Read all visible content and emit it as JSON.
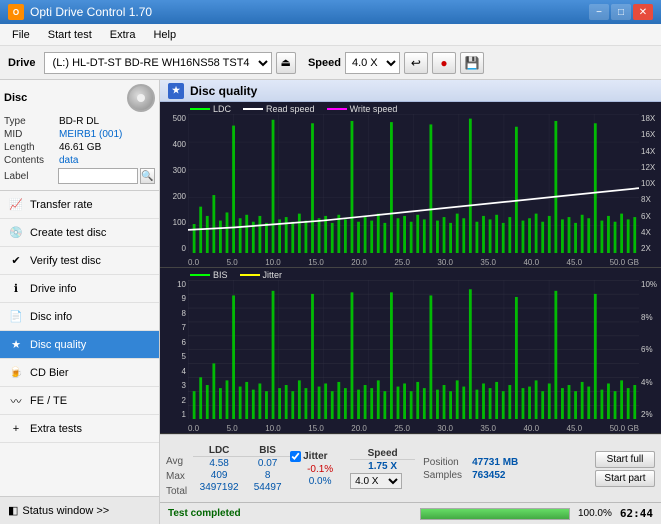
{
  "titleBar": {
    "appName": "Opti Drive Control 1.70",
    "iconText": "O",
    "btnMin": "−",
    "btnMax": "□",
    "btnClose": "✕"
  },
  "menuBar": {
    "items": [
      "File",
      "Start test",
      "Extra",
      "Help"
    ]
  },
  "toolbar": {
    "driveLabel": "Drive",
    "driveValue": "(L:)  HL-DT-ST BD-RE  WH16NS58 TST4",
    "ejectSymbol": "⏏",
    "speedLabel": "Speed",
    "speedValue": "4.0 X",
    "icons": [
      "↩",
      "🔴",
      "💾"
    ]
  },
  "disc": {
    "typeLabel": "Type",
    "typeValue": "BD-R DL",
    "midLabel": "MID",
    "midValue": "MEIRB1 (001)",
    "lengthLabel": "Length",
    "lengthValue": "46.61 GB",
    "contentsLabel": "Contents",
    "contentsValue": "data",
    "labelLabel": "Label",
    "labelValue": ""
  },
  "nav": {
    "items": [
      {
        "id": "transfer-rate",
        "label": "Transfer rate",
        "icon": "📈"
      },
      {
        "id": "create-test-disc",
        "label": "Create test disc",
        "icon": "💿"
      },
      {
        "id": "verify-test-disc",
        "label": "Verify test disc",
        "icon": "✔"
      },
      {
        "id": "drive-info",
        "label": "Drive info",
        "icon": "ℹ"
      },
      {
        "id": "disc-info",
        "label": "Disc info",
        "icon": "📄"
      },
      {
        "id": "disc-quality",
        "label": "Disc quality",
        "icon": "★",
        "active": true
      },
      {
        "id": "cd-bier",
        "label": "CD Bier",
        "icon": "🍺"
      },
      {
        "id": "fe-te",
        "label": "FE / TE",
        "icon": "〰"
      },
      {
        "id": "extra-tests",
        "label": "Extra tests",
        "icon": "+"
      }
    ]
  },
  "statusWindow": {
    "label": "Status window >>",
    "icon": "◧"
  },
  "discQuality": {
    "title": "Disc quality",
    "icon": "★",
    "chart1": {
      "legend": [
        {
          "label": "LDC",
          "color": "#00ff00"
        },
        {
          "label": "Read speed",
          "color": "#ffffff"
        },
        {
          "label": "Write speed",
          "color": "#ff00ff"
        }
      ],
      "yAxisLeft": [
        "500",
        "400",
        "300",
        "200",
        "100",
        "0"
      ],
      "yAxisRight": [
        "18X",
        "16X",
        "14X",
        "12X",
        "10X",
        "8X",
        "6X",
        "4X",
        "2X"
      ],
      "xAxisLabels": [
        "0.0",
        "5.0",
        "10.0",
        "15.0",
        "20.0",
        "25.0",
        "30.0",
        "35.0",
        "40.0",
        "45.0",
        "50.0 GB"
      ]
    },
    "chart2": {
      "legend": [
        {
          "label": "BIS",
          "color": "#00ff00"
        },
        {
          "label": "Jitter",
          "color": "#ffff00"
        }
      ],
      "yAxisLeft": [
        "10",
        "9",
        "8",
        "7",
        "6",
        "5",
        "4",
        "3",
        "2",
        "1"
      ],
      "yAxisRight": [
        "10%",
        "8%",
        "6%",
        "4%",
        "2%"
      ],
      "xAxisLabels": [
        "0.0",
        "5.0",
        "10.0",
        "15.0",
        "20.0",
        "25.0",
        "30.0",
        "35.0",
        "40.0",
        "45.0",
        "50.0 GB"
      ]
    }
  },
  "statsTable": {
    "headers": [
      "LDC",
      "BIS",
      "",
      "Jitter",
      "Speed"
    ],
    "rows": {
      "avg": {
        "label": "Avg",
        "ldc": "4.58",
        "bis": "0.07",
        "jitter": "-0.1%",
        "speed": "1.75 X"
      },
      "max": {
        "label": "Max",
        "ldc": "409",
        "bis": "8",
        "jitter": "0.0%",
        "speed": ""
      },
      "total": {
        "label": "Total",
        "ldc": "3497192",
        "bis": "54497",
        "jitter": "",
        "speed": ""
      }
    },
    "speedDropdown": "4.0 X",
    "position": {
      "label": "Position",
      "value": "47731 MB"
    },
    "samples": {
      "label": "Samples",
      "value": "763452"
    },
    "jitterChecked": true,
    "jitterLabel": "Jitter",
    "buttons": {
      "startFull": "Start full",
      "startPart": "Start part"
    }
  },
  "bottomBar": {
    "statusText": "Test completed",
    "progress": 100,
    "time": "62:44"
  }
}
